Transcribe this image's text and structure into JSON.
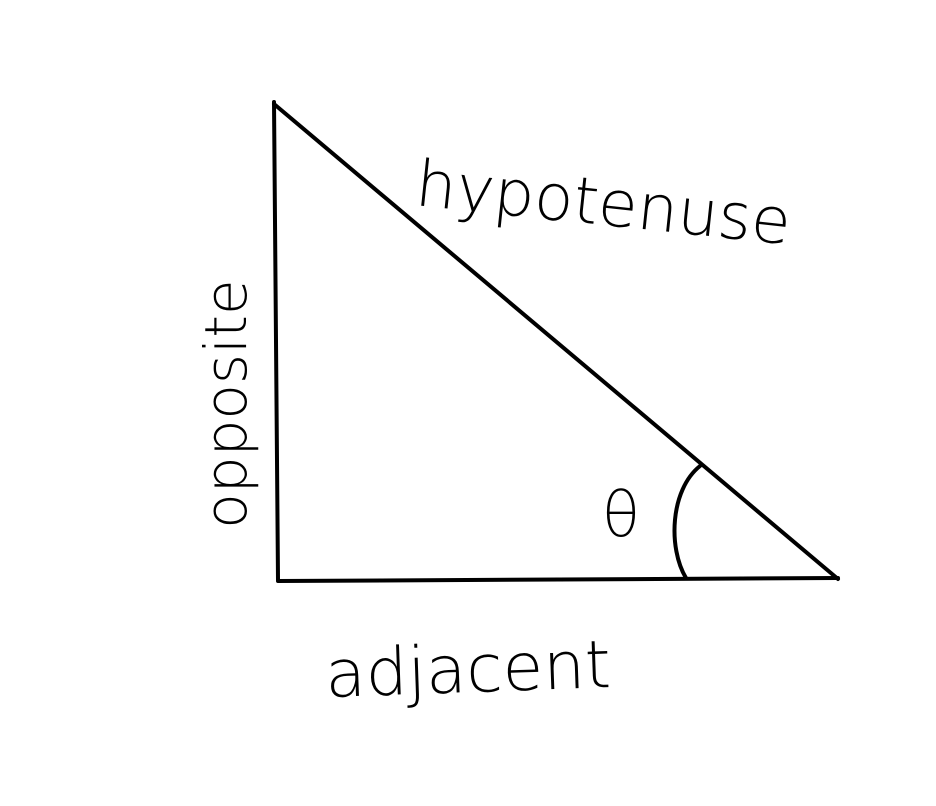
{
  "labels": {
    "hypotenuse": "hypotenuse",
    "opposite": "opposite",
    "adjacent": "adjacent",
    "angle": "θ"
  },
  "colors": {
    "ink": "#000000",
    "background": "#ffffff"
  }
}
